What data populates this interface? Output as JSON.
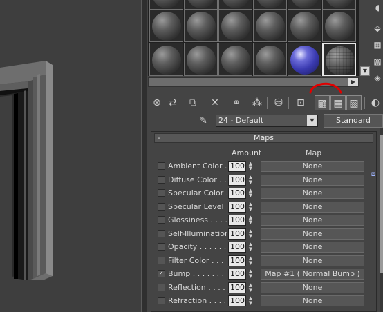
{
  "material": {
    "name": "24 - Default",
    "type": "Standard"
  },
  "maps": {
    "title": "Maps",
    "collapse_symbol": "-",
    "amount_header": "Amount",
    "map_header": "Map",
    "rows": [
      {
        "label": "Ambient Color . .",
        "checked": false,
        "amount": "100",
        "map": "None"
      },
      {
        "label": "Diffuse Color . . .",
        "checked": false,
        "amount": "100",
        "map": "None"
      },
      {
        "label": "Specular Color  .",
        "checked": false,
        "amount": "100",
        "map": "None"
      },
      {
        "label": "Specular Level  .",
        "checked": false,
        "amount": "100",
        "map": "None"
      },
      {
        "label": "Glossiness . . . .",
        "checked": false,
        "amount": "100",
        "map": "None"
      },
      {
        "label": "Self-Illumination .",
        "checked": false,
        "amount": "100",
        "map": "None"
      },
      {
        "label": "Opacity . . . . . .",
        "checked": false,
        "amount": "100",
        "map": "None"
      },
      {
        "label": "Filter Color  . . .",
        "checked": false,
        "amount": "100",
        "map": "None"
      },
      {
        "label": "Bump  . . . . . . .",
        "checked": true,
        "amount": "100",
        "map": "Map #1  ( Normal Bump )"
      },
      {
        "label": "Reflection  . . . .",
        "checked": false,
        "amount": "100",
        "map": "None"
      },
      {
        "label": "Refraction  . . . .",
        "checked": false,
        "amount": "100",
        "map": "None"
      }
    ]
  },
  "colors": {
    "panel_bg": "#444444",
    "annotation": "#e00000",
    "active_sphere": "#3a3ab0"
  },
  "icons": {
    "toolbar": [
      "get-material-icon",
      "put-to-scene-icon",
      "assign-to-selection-icon",
      "reset-icon",
      "make-copy-icon",
      "make-unique-icon",
      "put-to-library-icon",
      "material-id-icon",
      "show-map-icon",
      "show-end-result-icon",
      "go-to-parent-icon",
      "go-forward-icon"
    ],
    "side": [
      "sample-type-icon",
      "backlight-icon",
      "background-icon",
      "sample-uv-tiling-icon",
      "video-color-check-icon"
    ]
  }
}
